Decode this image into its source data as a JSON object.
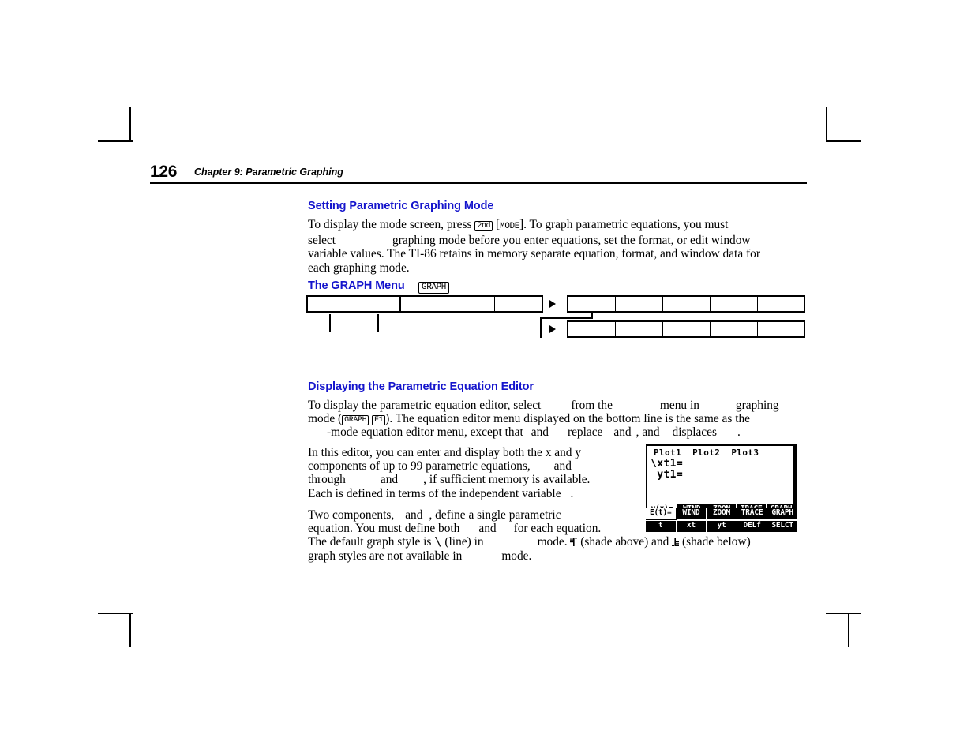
{
  "page": {
    "folio": "126",
    "running_head": "Chapter 9: Parametric Graphing"
  },
  "sections": [
    {
      "id": "setting-mode",
      "heading": "Setting Parametric Graphing Mode",
      "paragraph_runs": [
        "To display the mode screen, press ",
        "2nd",
        " [",
        "MODE",
        "]. To graph parametric equations, you must select ",
        "",
        " graphing mode before you enter equations, set the format, or edit window variable values. The TI-86 retains in memory separate equation, format, and window data for each graphing mode."
      ],
      "lines": [
        "To display the mode screen, press 2nd [MODE]. To graph parametric equations, you must",
        "select        graphing mode before you enter equations, set the format, or edit window",
        "variable values. The TI-86 retains in memory separate equation, format, and window data",
        "for each graphing mode."
      ]
    },
    {
      "id": "graph-menu",
      "heading": "The GRAPH Menu",
      "key_label": "GRAPH"
    },
    {
      "id": "equation-editor",
      "heading": "Displaying the Parametric Equation Editor",
      "lines": [
        "To display the parametric equation editor, select        from the           menu in           graphing",
        "mode (GRAPH F1). The equation editor menu displayed on the bottom line is the same as the",
        "      -mode equation editor menu, except that     and     replace     and   , and     displaces       ."
      ],
      "keys_inline": [
        "GRAPH",
        "F1"
      ]
    }
  ],
  "paragraphs": {
    "editor_body_lines": [
      "In this editor, you can enter and display both the x and y",
      "components of up to 99 parametric equations,        and",
      "through          and        , if sufficient memory is available.",
      "Each is defined in terms of the independent variable   ."
    ],
    "components_body_lines": [
      "Two components,     and    , define a single parametric",
      "equation. You must define both       and      for each equation.",
      "The default graph style is \\ (line) in              mode. ▌ (shade above) and ▄ (shade below)",
      "graph styles are not available in           mode."
    ]
  },
  "menu_map": {
    "row1_cells": [
      "",
      "",
      "",
      "",
      ""
    ],
    "row2_cells": [
      "",
      "",
      "",
      "",
      ""
    ],
    "row3_cells": [
      "",
      "",
      "",
      "",
      ""
    ]
  },
  "lcd_main": {
    "header": "Plot1  Plot2  Plot3",
    "line1": "\\xt1=",
    "line2": " yt1=",
    "menu_row1": [
      "y(x)=",
      "WIND",
      "ZOOM",
      "TRACE",
      "GRAPH"
    ],
    "menu_row2": [
      "t",
      "xt",
      "yt",
      "DELf",
      "SELCT"
    ],
    "menu_row1_selected_index": 0
  },
  "lcd_small": {
    "menu_row1": [
      "E(t)=",
      "WIND",
      "ZOOM",
      "TRACE",
      "GRAPH"
    ],
    "menu_row2": [
      "t",
      "xt",
      "yt",
      "DELf",
      "SELCT"
    ],
    "menu_row1_selected_index": 0
  },
  "colors": {
    "heading_blue": "#1414cc",
    "text_black": "#000000",
    "page_white": "#ffffff"
  }
}
